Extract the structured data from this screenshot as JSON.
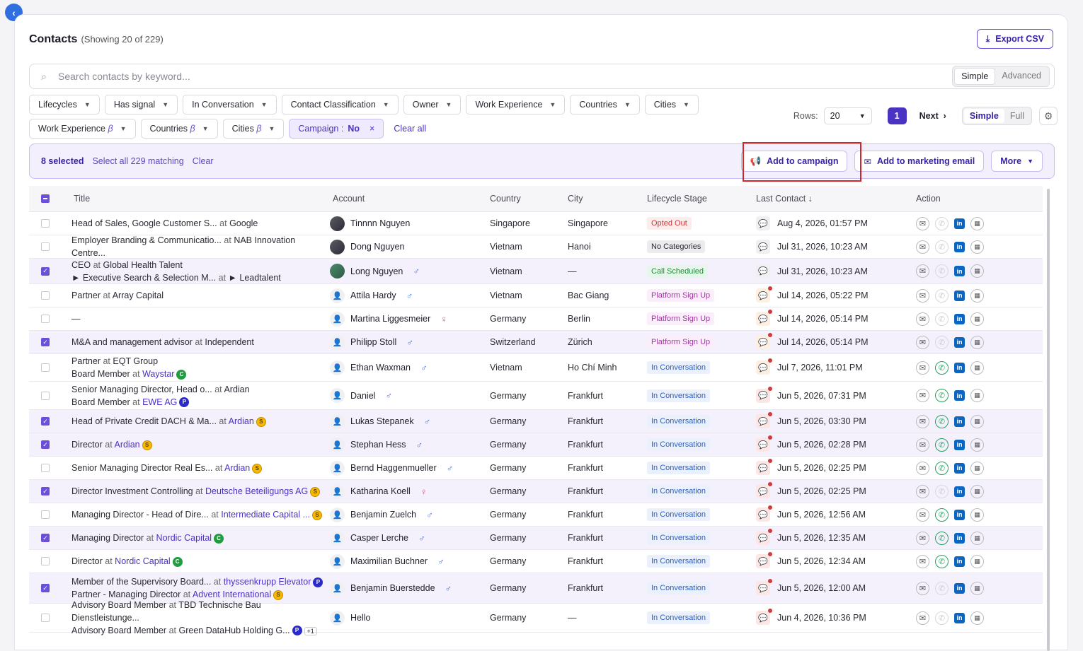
{
  "header": {
    "title": "Contacts",
    "subtitle": "(Showing 20 of 229)",
    "export_label": "Export CSV"
  },
  "search": {
    "placeholder": "Search contacts by keyword...",
    "modes": [
      "Simple",
      "Advanced"
    ],
    "active_mode": "Simple"
  },
  "filters_row1": [
    "Lifecycles",
    "Has signal",
    "In Conversation",
    "Contact Classification",
    "Owner",
    "Work Experience",
    "Countries",
    "Cities"
  ],
  "filters_row2": [
    {
      "label": "Work Experience",
      "beta": "β"
    },
    {
      "label": "Countries",
      "beta": "β"
    },
    {
      "label": "Cities",
      "beta": "β"
    }
  ],
  "campaign_chip": {
    "label": "Campaign : ",
    "value": "No",
    "remove": "×"
  },
  "clear_all": "Clear all",
  "pagination": {
    "rows_label": "Rows:",
    "rows_value": "20",
    "page": "1",
    "next": "Next",
    "views": [
      "Simple",
      "Full"
    ],
    "active_view": "Simple"
  },
  "selection": {
    "count_label": "8 selected",
    "select_all": "Select all 229 matching",
    "clear": "Clear",
    "add_campaign": "Add to campaign",
    "add_email": "Add to marketing email",
    "more": "More"
  },
  "columns": {
    "title": "Title",
    "account": "Account",
    "country": "Country",
    "city": "City",
    "lifecycle": "Lifecycle Stage",
    "last_contact": "Last Contact ↓",
    "action": "Action"
  },
  "rows": [
    {
      "sel": false,
      "h": 33,
      "lines": [
        {
          "t": "Head of Sales, Google Customer S...",
          "at": "at",
          "org": "Google",
          "link": false
        }
      ],
      "name": "Tinnnn Nguyen",
      "av": "photo",
      "g": "",
      "country": "Singapore",
      "city": "Singapore",
      "stage": "Opted Out",
      "st": "t-opt",
      "lc": "gray",
      "date": "Aug 4, 2026, 01:57 PM",
      "wa": false
    },
    {
      "sel": false,
      "h": 33,
      "lines": [
        {
          "t": "Employer Branding & Communicatio...",
          "at": "at",
          "org": "NAB Innovation Centre...",
          "link": false
        }
      ],
      "name": "Dong Nguyen",
      "av": "photo",
      "g": "",
      "country": "Vietnam",
      "city": "Hanoi",
      "stage": "No Categories",
      "st": "t-noc",
      "lc": "gray",
      "date": "Jul 31, 2026, 10:23 AM",
      "wa": false
    },
    {
      "sel": true,
      "h": 36,
      "lines": [
        {
          "t": "CEO",
          "at": "at",
          "org": "Global Health Talent",
          "link": false
        },
        {
          "t": "► Executive Search & Selection M...",
          "at": "at",
          "org": "► Leadtalent",
          "link": false
        }
      ],
      "name": "Long Nguyen",
      "av": "photo2",
      "g": "m",
      "country": "Vietnam",
      "city": "—",
      "stage": "Call Scheduled",
      "st": "t-call",
      "lc": "gray",
      "date": "Jul 31, 2026, 10:23 AM",
      "wa": false
    },
    {
      "sel": false,
      "h": 33,
      "lines": [
        {
          "t": "Partner",
          "at": "at",
          "org": "Array Capital",
          "link": false
        }
      ],
      "name": "Attila Hardy",
      "av": "ph",
      "g": "m",
      "country": "Vietnam",
      "city": "Bac Giang",
      "stage": "Platform Sign Up",
      "st": "t-plat",
      "lc": "orange",
      "date": "Jul 14, 2026, 05:22 PM",
      "wa": false
    },
    {
      "sel": false,
      "h": 33,
      "lines": [
        {
          "t": "—",
          "at": "",
          "org": "",
          "link": false
        }
      ],
      "name": "Martina Liggesmeier",
      "av": "ph",
      "g": "f",
      "country": "Germany",
      "city": "Berlin",
      "stage": "Platform Sign Up",
      "st": "t-plat",
      "lc": "orange",
      "date": "Jul 14, 2026, 05:14 PM",
      "wa": false
    },
    {
      "sel": true,
      "h": 33,
      "lines": [
        {
          "t": "M&A and management advisor",
          "at": "at",
          "org": "Independent",
          "link": false
        }
      ],
      "name": "Philipp Stoll",
      "av": "ph",
      "g": "m",
      "country": "Switzerland",
      "city": "Zürich",
      "stage": "Platform Sign Up",
      "st": "t-plat",
      "lc": "orange",
      "date": "Jul 14, 2026, 05:14 PM",
      "wa": false
    },
    {
      "sel": false,
      "h": 39,
      "lines": [
        {
          "t": "Partner",
          "at": "at",
          "org": "EQT Group",
          "link": false
        },
        {
          "t": "Board Member",
          "at": "at",
          "org": "Waystar",
          "link": true,
          "badge": "C"
        }
      ],
      "name": "Ethan Waxman",
      "av": "ph",
      "g": "m",
      "country": "Vietnam",
      "city": "Ho Chí Minh",
      "stage": "In Conversation",
      "st": "t-conv",
      "lc": "orange",
      "date": "Jul 7, 2026, 11:01 PM",
      "wa": true
    },
    {
      "sel": false,
      "h": 40,
      "lines": [
        {
          "t": "Senior Managing Director, Head o...",
          "at": "at",
          "org": "Ardian",
          "link": false
        },
        {
          "t": "Board Member",
          "at": "at",
          "org": "EWE AG",
          "link": true,
          "badge": "P"
        }
      ],
      "name": "Daniel",
      "av": "ph",
      "g": "m",
      "country": "Germany",
      "city": "Frankfurt",
      "stage": "In Conversation",
      "st": "t-conv",
      "lc": "red",
      "date": "Jun 5, 2026, 07:31 PM",
      "wa": true
    },
    {
      "sel": true,
      "h": 33,
      "lines": [
        {
          "t": "Head of Private Credit DACH & Ma...",
          "at": "at",
          "org": "Ardian",
          "link": true,
          "badge": "S"
        }
      ],
      "name": "Lukas Stepanek",
      "av": "ph",
      "g": "m",
      "country": "Germany",
      "city": "Frankfurt",
      "stage": "In Conversation",
      "st": "t-conv",
      "lc": "red",
      "date": "Jun 5, 2026, 03:30 PM",
      "wa": true
    },
    {
      "sel": true,
      "h": 33,
      "lines": [
        {
          "t": "Director",
          "at": "at",
          "org": "Ardian",
          "link": true,
          "badge": "S"
        }
      ],
      "name": "Stephan Hess",
      "av": "ph",
      "g": "m",
      "country": "Germany",
      "city": "Frankfurt",
      "stage": "In Conversation",
      "st": "t-conv",
      "lc": "red",
      "date": "Jun 5, 2026, 02:28 PM",
      "wa": true
    },
    {
      "sel": false,
      "h": 33,
      "lines": [
        {
          "t": "Senior Managing Director Real Es...",
          "at": "at",
          "org": "Ardian",
          "link": true,
          "badge": "S"
        }
      ],
      "name": "Bernd Haggenmueller",
      "av": "ph",
      "g": "m",
      "country": "Germany",
      "city": "Frankfurt",
      "stage": "In Conversation",
      "st": "t-conv",
      "lc": "red",
      "date": "Jun 5, 2026, 02:25 PM",
      "wa": true
    },
    {
      "sel": true,
      "h": 33,
      "lines": [
        {
          "t": "Director Investment Controlling",
          "at": "at",
          "org": "Deutsche Beteiligungs AG",
          "link": true,
          "badge": "S"
        }
      ],
      "name": "Katharina Koell",
      "av": "ph",
      "g": "f",
      "country": "Germany",
      "city": "Frankfurt",
      "stage": "In Conversation",
      "st": "t-conv",
      "lc": "red",
      "date": "Jun 5, 2026, 02:25 PM",
      "wa": false
    },
    {
      "sel": false,
      "h": 33,
      "lines": [
        {
          "t": "Managing Director - Head of Dire...",
          "at": "at",
          "org": "Intermediate Capital ...",
          "link": true,
          "badge": "S"
        }
      ],
      "name": "Benjamin Zuelch",
      "av": "ph",
      "g": "m",
      "country": "Germany",
      "city": "Frankfurt",
      "stage": "In Conversation",
      "st": "t-conv",
      "lc": "red",
      "date": "Jun 5, 2026, 12:56 AM",
      "wa": true
    },
    {
      "sel": true,
      "h": 33,
      "lines": [
        {
          "t": "Managing Director",
          "at": "at",
          "org": "Nordic Capital",
          "link": true,
          "badge": "C"
        }
      ],
      "name": "Casper Lerche",
      "av": "ph",
      "g": "m",
      "country": "Germany",
      "city": "Frankfurt",
      "stage": "In Conversation",
      "st": "t-conv",
      "lc": "red",
      "date": "Jun 5, 2026, 12:35 AM",
      "wa": true
    },
    {
      "sel": false,
      "h": 33,
      "lines": [
        {
          "t": "Director",
          "at": "at",
          "org": "Nordic Capital",
          "link": true,
          "badge": "C"
        }
      ],
      "name": "Maximilian Buchner",
      "av": "ph",
      "g": "m",
      "country": "Germany",
      "city": "Frankfurt",
      "stage": "In Conversation",
      "st": "t-conv",
      "lc": "red",
      "date": "Jun 5, 2026, 12:34 AM",
      "wa": true
    },
    {
      "sel": true,
      "h": 43,
      "lines": [
        {
          "t": "Member of the Supervisory Board...",
          "at": "at",
          "org": "thyssenkrupp Elevator",
          "link": true,
          "badge": "P"
        },
        {
          "t": "Partner - Managing Director",
          "at": "at",
          "org": "Advent International",
          "link": true,
          "badge": "S"
        }
      ],
      "name": "Benjamin Buerstedde",
      "av": "ph",
      "g": "m",
      "country": "Germany",
      "city": "Frankfurt",
      "stage": "In Conversation",
      "st": "t-conv",
      "lc": "red",
      "date": "Jun 5, 2026, 12:00 AM",
      "wa": false
    },
    {
      "sel": false,
      "h": 41,
      "lines": [
        {
          "t": "Advisory Board Member",
          "at": "at",
          "org": "TBD Technische Bau Dienstleistunge...",
          "link": false
        },
        {
          "t": "Advisory Board Member",
          "at": "at",
          "org": "Green DataHub Holding G...",
          "link": false,
          "badge": "P",
          "plus": "+1"
        }
      ],
      "name": "Hello",
      "av": "ph",
      "g": "",
      "country": "Germany",
      "city": "—",
      "stage": "In Conversation",
      "st": "t-conv",
      "lc": "red",
      "date": "Jun 4, 2026, 10:36 PM",
      "wa": false
    }
  ]
}
